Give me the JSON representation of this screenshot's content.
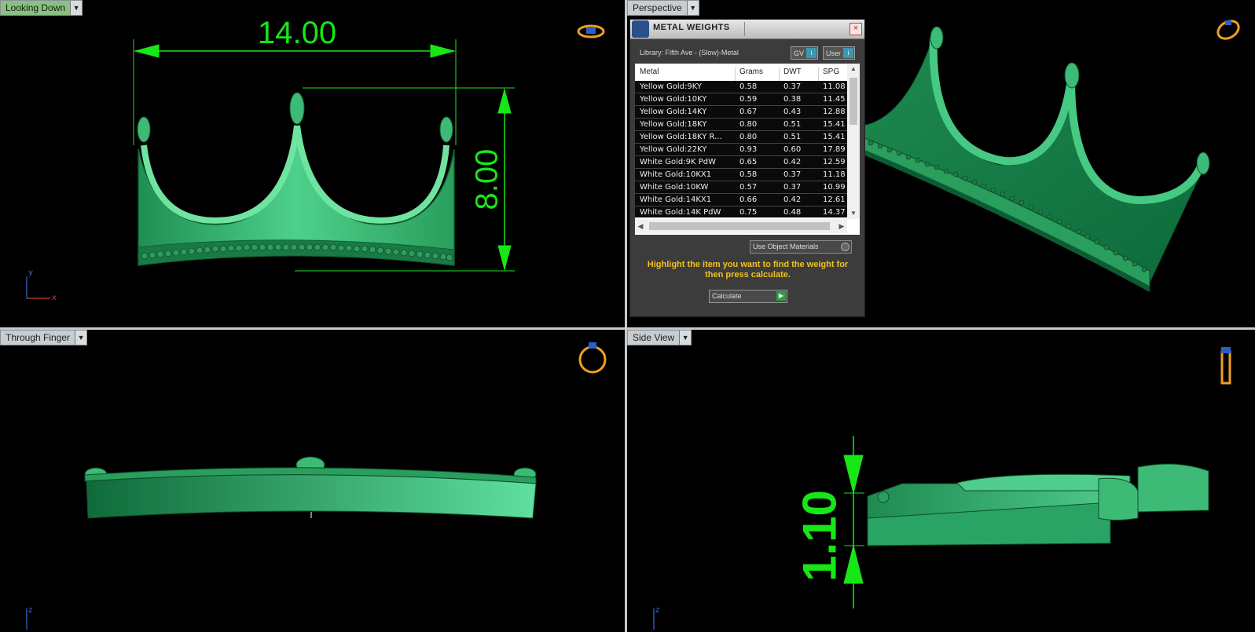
{
  "viewports": {
    "top_left": {
      "label": "Looking Down",
      "dim_width": "14.00",
      "dim_height": "8.00",
      "axis_y": "y",
      "axis_x": "x"
    },
    "top_right": {
      "label": "Perspective"
    },
    "bottom_left": {
      "label": "Through Finger",
      "axis_z": "z"
    },
    "bottom_right": {
      "label": "Side View",
      "dim_thickness": "1.10",
      "axis_z": "z"
    }
  },
  "metal_weights": {
    "title": "METAL WEIGHTS",
    "close": "×",
    "library": "Library: Fifth Ave - (Slow)-Metal",
    "toggle_gv": "GV",
    "toggle_user": "User",
    "toggle_icon": "i",
    "columns": [
      "Metal",
      "Grams",
      "DWT",
      "SPG"
    ],
    "rows": [
      [
        "Yellow Gold:9KY",
        "0.58",
        "0.37",
        "11.08"
      ],
      [
        "Yellow Gold:10KY",
        "0.59",
        "0.38",
        "11.45"
      ],
      [
        "Yellow Gold:14KY",
        "0.67",
        "0.43",
        "12.88"
      ],
      [
        "Yellow Gold:18KY",
        "0.80",
        "0.51",
        "15.41"
      ],
      [
        "Yellow Gold:18KY R...",
        "0.80",
        "0.51",
        "15.41"
      ],
      [
        "Yellow Gold:22KY",
        "0.93",
        "0.60",
        "17.89"
      ],
      [
        "White Gold:9K PdW",
        "0.65",
        "0.42",
        "12.59"
      ],
      [
        "White Gold:10KX1",
        "0.58",
        "0.37",
        "11.18"
      ],
      [
        "White Gold:10KW",
        "0.57",
        "0.37",
        "10.99"
      ],
      [
        "White Gold:14KX1",
        "0.66",
        "0.42",
        "12.61"
      ],
      [
        "White Gold:14K PdW",
        "0.75",
        "0.48",
        "14.37"
      ]
    ],
    "use_object_materials": "Use Object Materials",
    "message": "Highlight the item you want to find the weight for then press calculate.",
    "calculate": "Calculate"
  },
  "colors": {
    "dimension": "#17e617",
    "model": "#2fa564",
    "panel_message": "#f2c21b",
    "active_tab": "#8bbf84"
  },
  "icons": [
    "ring-view-icon",
    "dropdown-arrow-icon",
    "close-icon",
    "info-icon",
    "play-icon"
  ]
}
